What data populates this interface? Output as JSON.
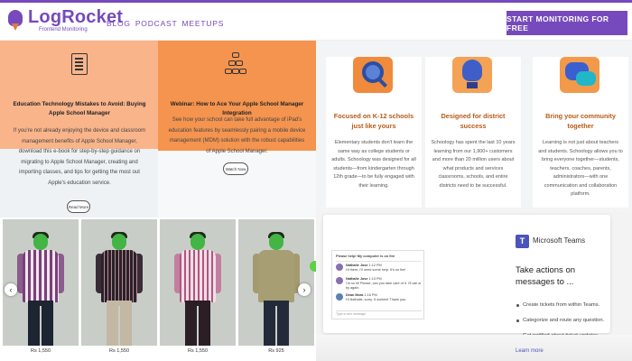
{
  "header": {
    "logo_name": "LogRocket",
    "logo_sub": "Frontend Monitoring",
    "nav": [
      "BLOG",
      "PODCAST",
      "MEETUPS"
    ],
    "cta": "START MONITORING FOR FREE",
    "colors": {
      "brand": "#764abc",
      "accent_flame": "#e07a3f"
    }
  },
  "blog_cards": [
    {
      "icon": "checklist-icon",
      "title": "Education Technology Mistakes to Avoid: Buying Apple School Manager",
      "text": "If you're not already enjoying the device and classroom management benefits of Apple School Manager, download this e-book for step-by-step guidance on migrating to Apple School Manager, creating and importing classes, and tips for getting the most out Apple's education service.",
      "button": "Read More"
    },
    {
      "icon": "tiered-org-icon",
      "title": "Webinar: How to Ace Your Apple School Manager Integration",
      "text": "See how your school can take full advantage of iPad's education features by seamlessly pairing a mobile device management (MDM) solution with the robust capabilities of Apple School Manager.",
      "button": "Watch Now"
    }
  ],
  "products": [
    {
      "price": "Rs 1,550",
      "shirt": "checkered-purple"
    },
    {
      "price": "Rs 1,550",
      "shirt": "checkered-dark"
    },
    {
      "price": "Rs 1,550",
      "shirt": "checkered-pink"
    },
    {
      "price": "Rs 925",
      "shirt": "khaki"
    }
  ],
  "schoology": [
    {
      "icon": "magnifier-school-icon",
      "title": "Focused on K-12 schools just like yours",
      "text": "Elementary students don't learn the same way as college students or adults. Schoology was designed for all students—from kindergarten through 12th grade—to be fully engaged with their learning."
    },
    {
      "icon": "lightbulb-icon",
      "title": "Designed for district success",
      "text": "Schoology has spent the last 10 years learning from our 1,900+ customers and more than 20 million users about what products and services classrooms, schools, and entire districts need to be successful."
    },
    {
      "icon": "chat-bubbles-icon",
      "title": "Bring your community together",
      "text": "Learning is not just about teachers and students. Schoology allows you to bring everyone together—students, teachers, coaches, parents, administrators—with one communication and collaboration platform."
    }
  ],
  "teams": {
    "product": "Microsoft Teams",
    "title": "Take actions on messages to ...",
    "bullets": [
      "Create tickets from within Teams.",
      "Categorize and route any question.",
      "Get notified about ticket updates."
    ],
    "learn_more": "Learn more",
    "chat": {
      "header": "Please help! My computer is on fire",
      "messages": [
        {
          "name": "Nathalie Jose",
          "time": "1:12 PM",
          "text": "Hi there, I'll need some help. It's on fire!"
        },
        {
          "name": "Nathalie Jose",
          "time": "1:13 PM",
          "text": "I'm so lit! Please, can you take care of it. I'll call or by again."
        },
        {
          "name": "Dean Mora",
          "time": "1:16 PM",
          "text": "Hi Nathalie, sorry. It worked! Thank you."
        }
      ],
      "input_placeholder": "Type a new message"
    }
  }
}
